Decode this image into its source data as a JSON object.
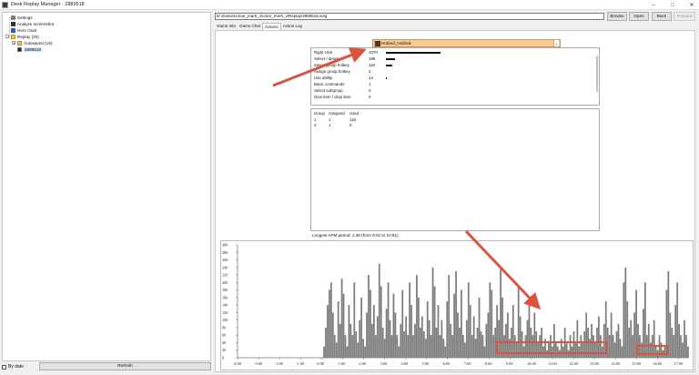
{
  "window": {
    "title": "Desk Replay Manager - 2889518",
    "controls": {
      "minimize": "–",
      "maximize": "□",
      "close": "✕"
    }
  },
  "tree": {
    "items": [
      {
        "label": "Settings",
        "icon": "gear-icon"
      },
      {
        "label": "Analyze screenshot",
        "icon": "camera-icon"
      },
      {
        "label": "Hero chart",
        "icon": "hero-icon"
      },
      {
        "label": "Replay (20)",
        "icon": "folder-icon",
        "toggle": "-"
      },
      {
        "label": "Autosaved (19)",
        "icon": "folder-icon",
        "toggle": "+"
      },
      {
        "label": "2889518",
        "icon": "replay-icon",
        "selected": true
      }
    ]
  },
  "bottom_left": {
    "checkbox_label": "By date",
    "refresh_label": "Refresh"
  },
  "path": {
    "value": "D:\\Games\\cmar_mar5_v\\cmar_mar5_v\\Replay\\2889518.w3g",
    "buttons": [
      {
        "label": "Browse",
        "enabled": true
      },
      {
        "label": "Open",
        "enabled": true
      },
      {
        "label": "Back",
        "enabled": true
      },
      {
        "label": "Forward",
        "enabled": false
      }
    ]
  },
  "tabs": [
    {
      "label": "Game Info",
      "active": false
    },
    {
      "label": "Game Chat",
      "active": false
    },
    {
      "label": "Actions",
      "active": true
    },
    {
      "label": "Action Log",
      "active": false
    }
  ],
  "player_select": {
    "value": "Hotbed_Hotbed-"
  },
  "stats": [
    {
      "label": "Right click",
      "value": "1070",
      "bar": 0.6
    },
    {
      "label": "Select / deselect",
      "value": "186",
      "bar": 0.1
    },
    {
      "label": "Select group hotkey",
      "value": "118",
      "bar": 0.07
    },
    {
      "label": "Assign group hotkey",
      "value": "2",
      "bar": 0
    },
    {
      "label": "Use ability",
      "value": "14",
      "bar": 0.01
    },
    {
      "label": "Basic commands",
      "value": "1",
      "bar": 0
    },
    {
      "label": "Select subgroup",
      "value": "0",
      "bar": 0
    },
    {
      "label": "Give item / drop item",
      "value": "0",
      "bar": 0
    }
  ],
  "groups": {
    "headers": [
      "Group",
      "Assigned",
      "Used"
    ],
    "rows": [
      [
        "1",
        "1",
        "118"
      ],
      [
        "3",
        "1",
        "0"
      ]
    ]
  },
  "apm_label": "Longest APM period: 1:48 (from 9:02 to 10:51)",
  "chart_data": {
    "type": "bar",
    "title": "",
    "xlabel": "",
    "ylabel": "",
    "ylim": [
      0,
      300
    ],
    "y_ticks": [
      "300",
      "280",
      "260",
      "240",
      "220",
      "200",
      "180",
      "160",
      "140",
      "120",
      "100",
      "80",
      "60",
      "40",
      "20",
      "0"
    ],
    "x_ticks": [
      "-4:00",
      "-3:00",
      "-2:00",
      "-1:00",
      "0:00",
      "1:00",
      "2:00",
      "3:00",
      "4:00",
      "5:00",
      "6:00",
      "7:00",
      "8:00",
      "9:00",
      "10:00",
      "11:00",
      "12:00",
      "13:00",
      "14:00",
      "15:00",
      "16:00",
      "17:00"
    ],
    "x_range_minutes": [
      -4,
      17.5
    ],
    "values_approx_per_5s": [
      0,
      0,
      0,
      0,
      0,
      0,
      0,
      0,
      0,
      0,
      0,
      0,
      0,
      0,
      0,
      0,
      0,
      0,
      0,
      0,
      0,
      0,
      0,
      0,
      0,
      0,
      0,
      0,
      0,
      0,
      0,
      0,
      0,
      0,
      0,
      0,
      0,
      0,
      0,
      0,
      0,
      0,
      0,
      0,
      0,
      0,
      0,
      0,
      30,
      80,
      140,
      180,
      200,
      120,
      60,
      40,
      150,
      90,
      210,
      170,
      60,
      30,
      140,
      90,
      60,
      200,
      70,
      40,
      100,
      160,
      50,
      30,
      120,
      220,
      180,
      90,
      140,
      60,
      110,
      250,
      190,
      80,
      50,
      130,
      200,
      100,
      60,
      170,
      120,
      60,
      30,
      90,
      180,
      70,
      110,
      60,
      200,
      140,
      60,
      90,
      220,
      160,
      80,
      110,
      70,
      50,
      150,
      100,
      60,
      240,
      190,
      80,
      140,
      60,
      100,
      50,
      30,
      150,
      220,
      90,
      60,
      170,
      230,
      120,
      80,
      180,
      60,
      40,
      100,
      200,
      140,
      60,
      110,
      50,
      80,
      160,
      70,
      60,
      30,
      90,
      120,
      200,
      180,
      60,
      80,
      140,
      100,
      240,
      160,
      60,
      90,
      120,
      50,
      80,
      140,
      60,
      40,
      190,
      110,
      70,
      30,
      60,
      100,
      140,
      80,
      60,
      120,
      70,
      40,
      60,
      80,
      30,
      50,
      20,
      40,
      60,
      30,
      90,
      40,
      30,
      20,
      50,
      30,
      80,
      40,
      20,
      60,
      30,
      70,
      40,
      100,
      30,
      60,
      40,
      70,
      120,
      80,
      50,
      90,
      60,
      40,
      80,
      110,
      60,
      30,
      90,
      150,
      80,
      60,
      120,
      60,
      40,
      70,
      90,
      50,
      30,
      200,
      240,
      150,
      80,
      100,
      60,
      120,
      180,
      90,
      60,
      40,
      130,
      200,
      60,
      90,
      40,
      60,
      100,
      30,
      20,
      60,
      40,
      20,
      30,
      180,
      230,
      120,
      80,
      60,
      140,
      200,
      90,
      60,
      40,
      100,
      60,
      30
    ]
  },
  "annotations": {
    "arrow_color": "#d9533f",
    "highlight_color": "#d9533f"
  }
}
